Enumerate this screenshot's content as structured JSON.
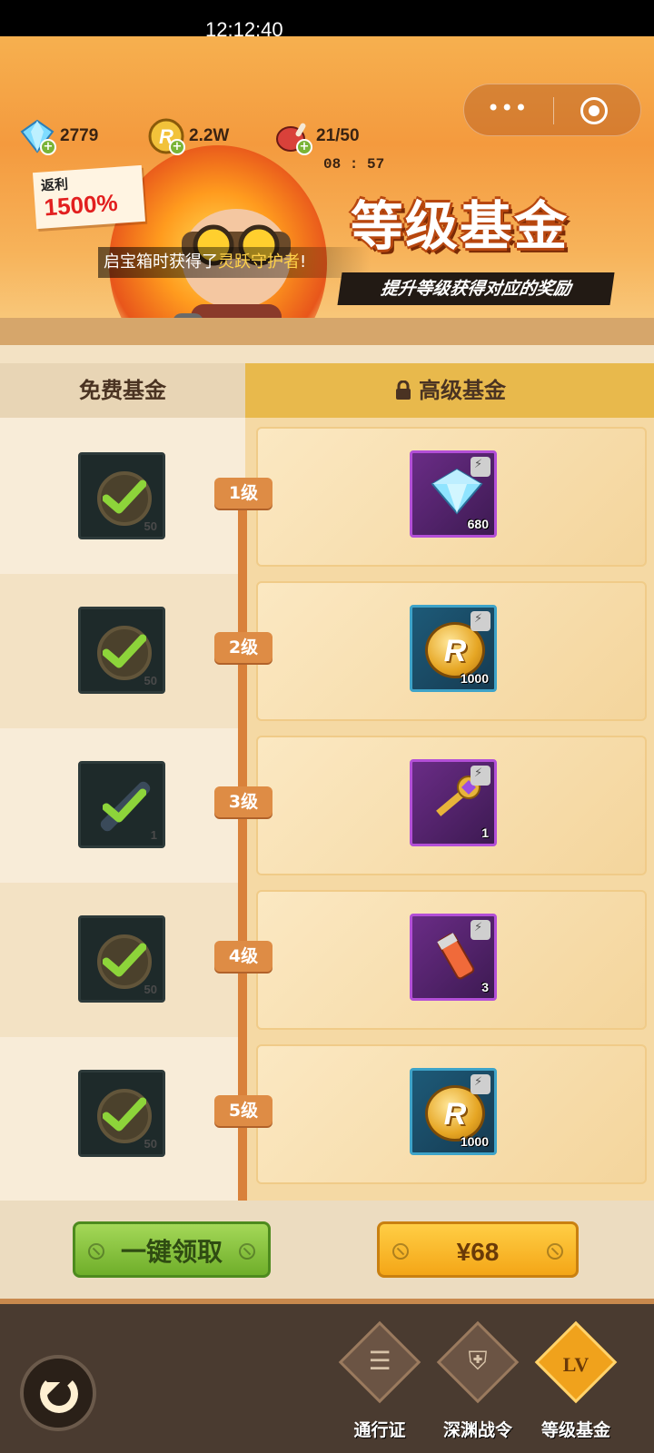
{
  "status": {
    "time": "12:12:40"
  },
  "resources": {
    "gems": "2779",
    "coins": "2.2W",
    "stamina": "21/50",
    "timer": "08 : 57"
  },
  "capsule": {
    "menu_dots": "•••"
  },
  "banner": {
    "rebate_label": "返利",
    "rebate_value": "1500%",
    "notice_prefix": "启宝箱时获得了",
    "notice_highlight": "灵跃守护者",
    "notice_suffix": "!",
    "title": "等级基金",
    "subtitle": "提升等级获得对应的奖励"
  },
  "tabs": {
    "free": "免费基金",
    "premium": "高级基金"
  },
  "rows": [
    {
      "level": "1级",
      "free_qty": "50",
      "prem_qty": "680"
    },
    {
      "level": "2级",
      "free_qty": "50",
      "prem_qty": "1000"
    },
    {
      "level": "3级",
      "free_qty": "1",
      "prem_qty": "1"
    },
    {
      "level": "4级",
      "free_qty": "50",
      "prem_qty": "3"
    },
    {
      "level": "5级",
      "free_qty": "50",
      "prem_qty": "1000"
    }
  ],
  "actions": {
    "claim_all": "一键领取",
    "buy": "¥68"
  },
  "nav": {
    "pass": "通行证",
    "abyss": "深渊战令",
    "level_fund": "等级基金",
    "level_badge": "LV"
  },
  "colors": {
    "accent_orange": "#f49a3e",
    "claim_green": "#7ab437",
    "buy_gold": "#f4a617",
    "check_green": "#8dd43a"
  }
}
